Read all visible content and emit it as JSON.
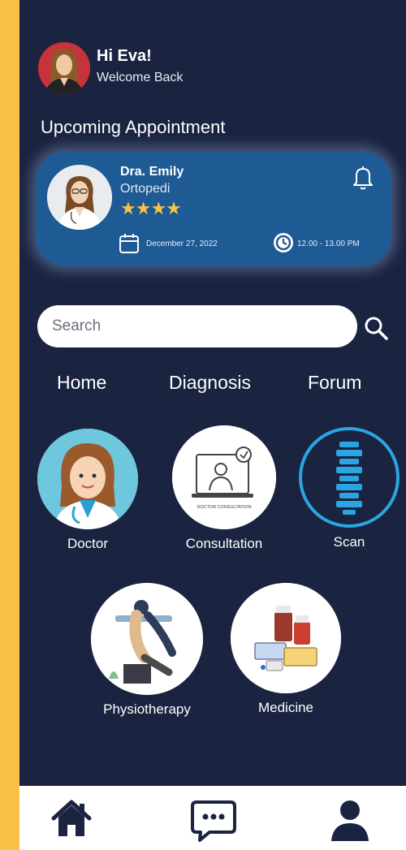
{
  "user": {
    "greeting": "Hi Eva!",
    "subtitle": "Welcome Back"
  },
  "section_title": "Upcoming Appointment",
  "appointment": {
    "doctor_name": "Dra. Emily",
    "specialty": "Ortopedi",
    "rating_stars": "★★★★",
    "date": "December 27, 2022",
    "time": "12.00 - 13.00 PM"
  },
  "search": {
    "placeholder": "Search"
  },
  "tabs": [
    "Home",
    "Diagnosis",
    "Forum"
  ],
  "services": {
    "doctor": "Doctor",
    "consultation": "Consultation",
    "consultation_caption": "DOCTOR CONSULTATION",
    "scan": "Scan",
    "physiotherapy": "Physiotherapy",
    "medicine": "Medicine"
  },
  "colors": {
    "background": "#1A2340",
    "card": "#1E5A94",
    "accent_stripe": "#F8C246",
    "stars": "#F8C246",
    "scan_ring": "#2AA5E0"
  },
  "icons": [
    "bell-icon",
    "calendar-icon",
    "clock-icon",
    "search-icon",
    "home-icon",
    "chat-icon",
    "profile-icon"
  ]
}
